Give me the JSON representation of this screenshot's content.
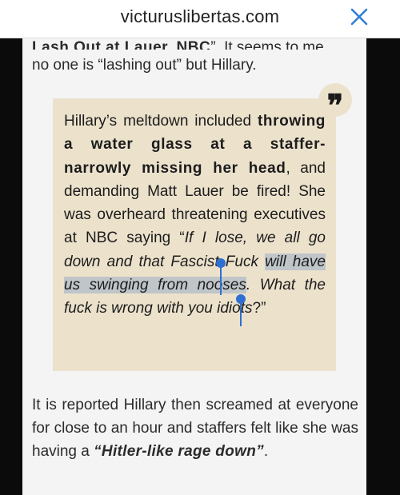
{
  "browser": {
    "url": "victuruslibertas.com",
    "close_icon": "close-icon"
  },
  "article": {
    "cut_line_prefix": "Lash Out at Lauer, NBC",
    "cut_line_suffix": "”. It seems to me,",
    "intro_tail": "no one is “lashing out” but Hillary.",
    "quote": {
      "icon": "quote-mark-icon",
      "mark": "❞",
      "p1": "Hillary’s meltdown included ",
      "p2_bold": "throwing a water glass at a staffer- narrowly missing her head",
      "p3": ", and demanding Matt Lauer be fired! She was overheard threatening executives at NBC saying “",
      "p4_italic": "If I lose, we all go down and that Fascist Fuck ",
      "p5_selected": "will have us swinging from nooses",
      "p6_italic": ". What the fuck is wrong with you idiots",
      "p7": "?”"
    },
    "after_quote_1": "It is reported Hillary then screamed at everyone for close to an hour and staffers felt like she was having a ",
    "after_quote_emph": "“Hitler-like rage down”",
    "after_quote_2": "."
  },
  "colors": {
    "quote_background": "#ece2cc",
    "selection_highlight": "#bfc5c8",
    "selection_handle": "#2f6fd1",
    "sidebar": "#0b0b0b"
  }
}
